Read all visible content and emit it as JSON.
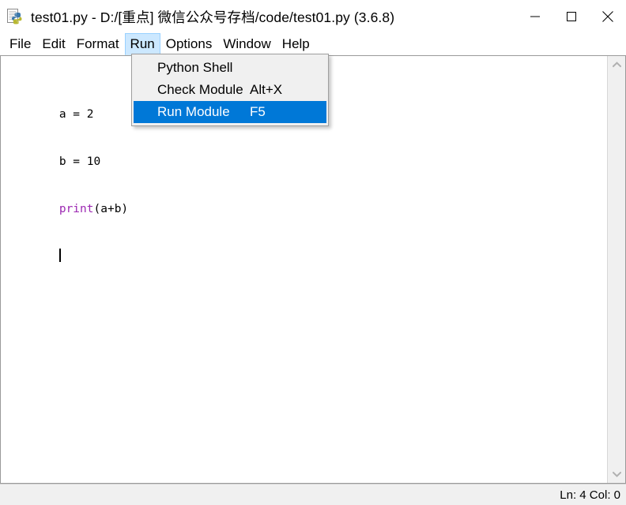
{
  "window": {
    "title": "test01.py - D:/[重点] 微信公众号存档/code/test01.py (3.6.8)",
    "icon": "python-file-icon",
    "controls": {
      "minimize_label": "Minimize",
      "maximize_label": "Maximize",
      "close_label": "Close"
    }
  },
  "menubar": {
    "items": [
      {
        "label": "File",
        "open": false
      },
      {
        "label": "Edit",
        "open": false
      },
      {
        "label": "Format",
        "open": false
      },
      {
        "label": "Run",
        "open": true
      },
      {
        "label": "Options",
        "open": false
      },
      {
        "label": "Window",
        "open": false
      },
      {
        "label": "Help",
        "open": false
      }
    ]
  },
  "run_menu": {
    "items": [
      {
        "label": "Python Shell",
        "accel": "",
        "selected": false
      },
      {
        "label": "Check Module",
        "accel": "Alt+X",
        "selected": false
      },
      {
        "label": "Run Module",
        "accel": "F5",
        "selected": true
      }
    ]
  },
  "editor": {
    "lines": [
      {
        "segments": [
          {
            "text": "a = 2",
            "type": "plain"
          }
        ]
      },
      {
        "segments": [
          {
            "text": "b = 10",
            "type": "plain"
          }
        ]
      },
      {
        "segments": [
          {
            "text": "print",
            "type": "keyword"
          },
          {
            "text": "(a+b)",
            "type": "plain"
          }
        ]
      },
      {
        "segments": [
          {
            "text": "",
            "type": "plain"
          }
        ]
      }
    ],
    "caret_line": 4
  },
  "scrollbar": {
    "up_arrow": "chevron-up-icon",
    "down_arrow": "chevron-down-icon"
  },
  "status": {
    "position": "Ln: 4  Col: 0"
  },
  "colors": {
    "accent_blue": "#0078d7",
    "menu_highlight": "#cce8ff",
    "keyword_purple": "#9c28b2",
    "chrome_gray": "#f0f0f0"
  }
}
